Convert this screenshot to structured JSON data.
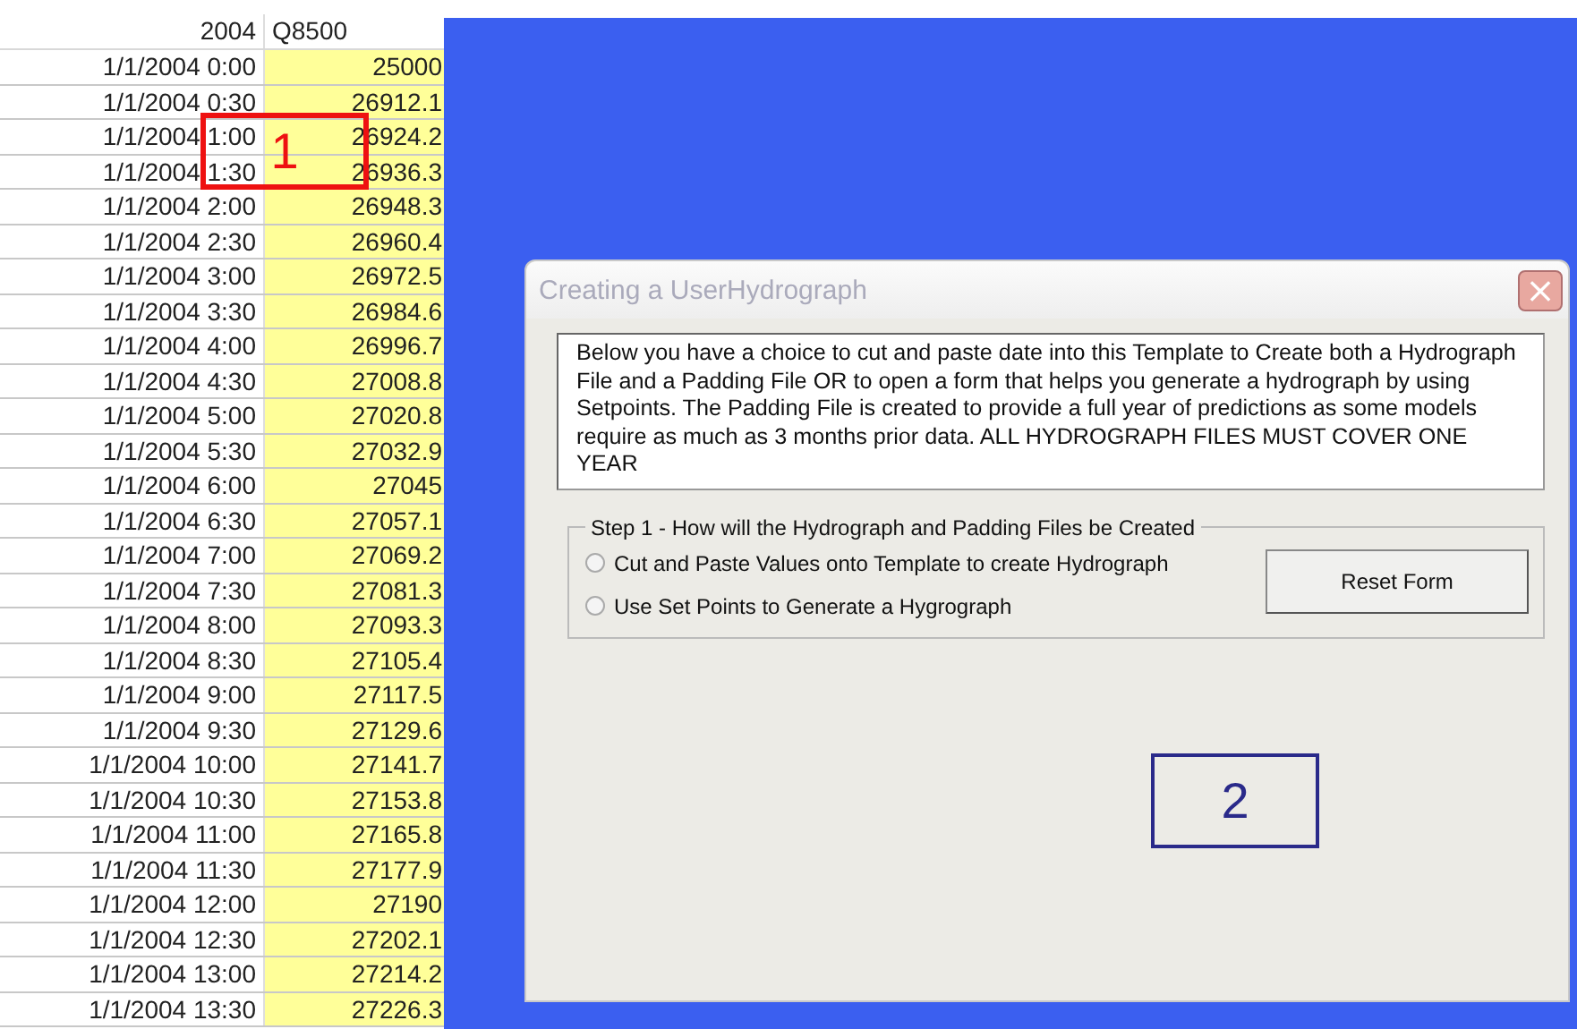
{
  "sheet": {
    "columns": [
      "2004",
      "Q8500"
    ],
    "rows": [
      [
        "1/1/2004 0:00",
        "25000"
      ],
      [
        "1/1/2004 0:30",
        "26912.1"
      ],
      [
        "1/1/2004 1:00",
        "26924.2"
      ],
      [
        "1/1/2004 1:30",
        "26936.3"
      ],
      [
        "1/1/2004 2:00",
        "26948.3"
      ],
      [
        "1/1/2004 2:30",
        "26960.4"
      ],
      [
        "1/1/2004 3:00",
        "26972.5"
      ],
      [
        "1/1/2004 3:30",
        "26984.6"
      ],
      [
        "1/1/2004 4:00",
        "26996.7"
      ],
      [
        "1/1/2004 4:30",
        "27008.8"
      ],
      [
        "1/1/2004 5:00",
        "27020.8"
      ],
      [
        "1/1/2004 5:30",
        "27032.9"
      ],
      [
        "1/1/2004 6:00",
        "27045"
      ],
      [
        "1/1/2004 6:30",
        "27057.1"
      ],
      [
        "1/1/2004 7:00",
        "27069.2"
      ],
      [
        "1/1/2004 7:30",
        "27081.3"
      ],
      [
        "1/1/2004 8:00",
        "27093.3"
      ],
      [
        "1/1/2004 8:30",
        "27105.4"
      ],
      [
        "1/1/2004 9:00",
        "27117.5"
      ],
      [
        "1/1/2004 9:30",
        "27129.6"
      ],
      [
        "1/1/2004 10:00",
        "27141.7"
      ],
      [
        "1/1/2004 10:30",
        "27153.8"
      ],
      [
        "1/1/2004 11:00",
        "27165.8"
      ],
      [
        "1/1/2004 11:30",
        "27177.9"
      ],
      [
        "1/1/2004 12:00",
        "27190"
      ],
      [
        "1/1/2004 12:30",
        "27202.1"
      ],
      [
        "1/1/2004 13:00",
        "27214.2"
      ],
      [
        "1/1/2004 13:30",
        "27226.3"
      ]
    ]
  },
  "dialog": {
    "title": "Creating a UserHydrograph",
    "close": "×",
    "description": "Below you have a choice to cut and paste date into this Template to Create both a Hydrograph File and a Padding File OR to open a form that helps you generate a hydrograph by using Setpoints.    The Padding File is created to provide a full year of predictions as some models require as much as 3 months prior data.  ALL HYDROGRAPH FILES MUST COVER ONE YEAR",
    "step": {
      "legend": "Step 1 - How will the Hydrograph and Padding Files be Created",
      "options": [
        {
          "label": "Cut and Paste Values onto Template to create Hydrograph",
          "selected": false
        },
        {
          "label": "Use Set Points to Generate a Hygrograph",
          "selected": false
        }
      ],
      "button": "Reset Form"
    }
  },
  "annotations": [
    {
      "label": "1",
      "color": "#ee1111",
      "kind": "sheet"
    },
    {
      "label": "2",
      "color": "#2a2a8a",
      "kind": "dialog"
    }
  ]
}
